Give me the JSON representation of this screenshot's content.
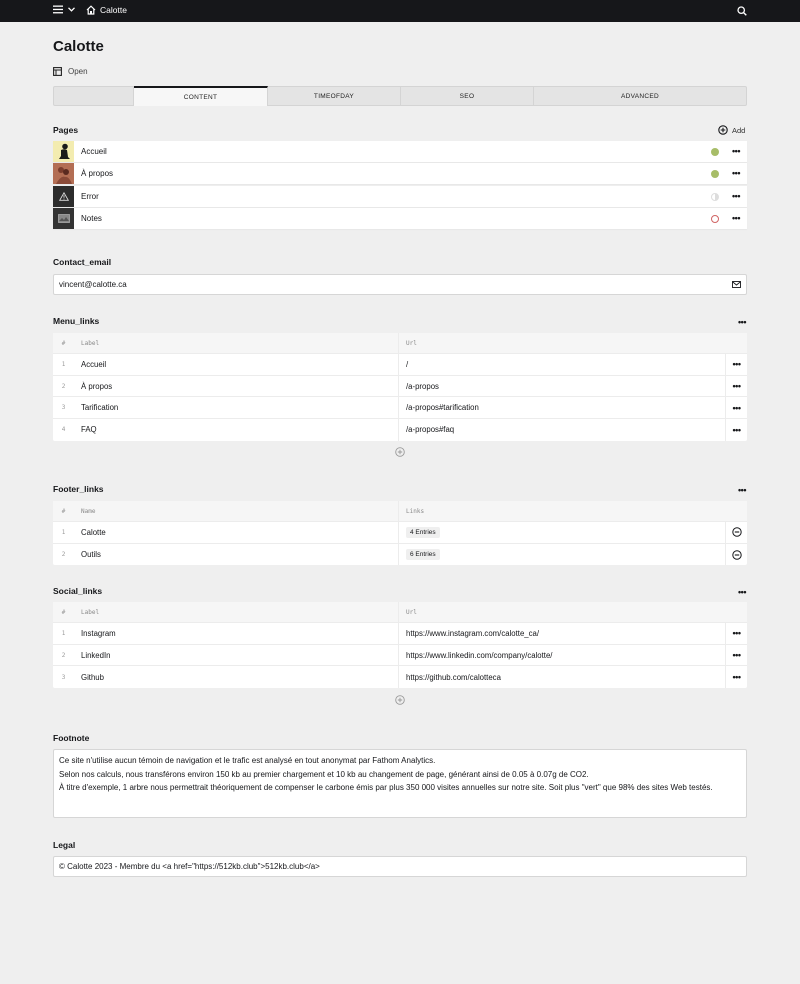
{
  "topbar": {
    "site_name": "Calotte",
    "menu_icon": "hamburger-icon",
    "search_icon": "search-icon"
  },
  "page": {
    "title": "Calotte",
    "status_label": "Open"
  },
  "tabs": [
    {
      "label": ""
    },
    {
      "label": "CONTENT",
      "active": true
    },
    {
      "label": "TIMEOFDAY"
    },
    {
      "label": "SEO"
    },
    {
      "label": "ADVANCED"
    }
  ],
  "pages_section": {
    "label": "Pages",
    "add_label": "Add",
    "items": [
      {
        "name": "Accueil",
        "status": "listed",
        "status_color": "#a7bd68"
      },
      {
        "name": "À propos",
        "status": "listed",
        "status_color": "#a7bd68"
      },
      {
        "name": "Error",
        "status": "unlisted",
        "status_color": "#dddddd"
      },
      {
        "name": "Notes",
        "status": "draft",
        "status_color": "#d16464"
      }
    ]
  },
  "contact_email": {
    "label": "Contact_email",
    "value": "vincent@calotte.ca"
  },
  "menu_links": {
    "label": "Menu_links",
    "headers": {
      "idx": "#",
      "a": "Label",
      "b": "Url"
    },
    "rows": [
      {
        "idx": "1",
        "a": "Accueil",
        "b": "/"
      },
      {
        "idx": "2",
        "a": "À propos",
        "b": "/a-propos"
      },
      {
        "idx": "3",
        "a": "Tarification",
        "b": "/a-propos#tarification"
      },
      {
        "idx": "4",
        "a": "FAQ",
        "b": "/a-propos#faq"
      }
    ]
  },
  "footer_links": {
    "label": "Footer_links",
    "headers": {
      "idx": "#",
      "a": "Name",
      "b": "Links"
    },
    "rows": [
      {
        "idx": "1",
        "a": "Calotte",
        "b": "4 Entries"
      },
      {
        "idx": "2",
        "a": "Outils",
        "b": "6 Entries"
      }
    ]
  },
  "social_links": {
    "label": "Social_links",
    "headers": {
      "idx": "#",
      "a": "Label",
      "b": "Url"
    },
    "rows": [
      {
        "idx": "1",
        "a": "Instagram",
        "b": "https://www.instagram.com/calotte_ca/"
      },
      {
        "idx": "2",
        "a": "LinkedIn",
        "b": "https://www.linkedin.com/company/calotte/"
      },
      {
        "idx": "3",
        "a": "Github",
        "b": "https://github.com/calotteca"
      }
    ]
  },
  "footnote": {
    "label": "Footnote",
    "lines": [
      "Ce site n'utilise aucun témoin de navigation et le trafic est analysé en tout anonymat par Fathom Analytics.",
      "Selon nos calculs, nous transférons environ 150 kb au premier chargement et 10 kb au changement de page, générant ainsi de 0.05 à 0.07g de CO2.",
      "À titre d'exemple, 1 arbre nous permettrait théoriquement de compenser le carbone émis par plus 350 000 visites annuelles sur notre site. Soit plus \"vert\" que 98% des sites Web testés."
    ]
  },
  "legal": {
    "label": "Legal",
    "value": "© Calotte 2023 - Membre du <a href=\"https://512kb.club\">512kb.club</a>"
  },
  "more_label": "•••"
}
